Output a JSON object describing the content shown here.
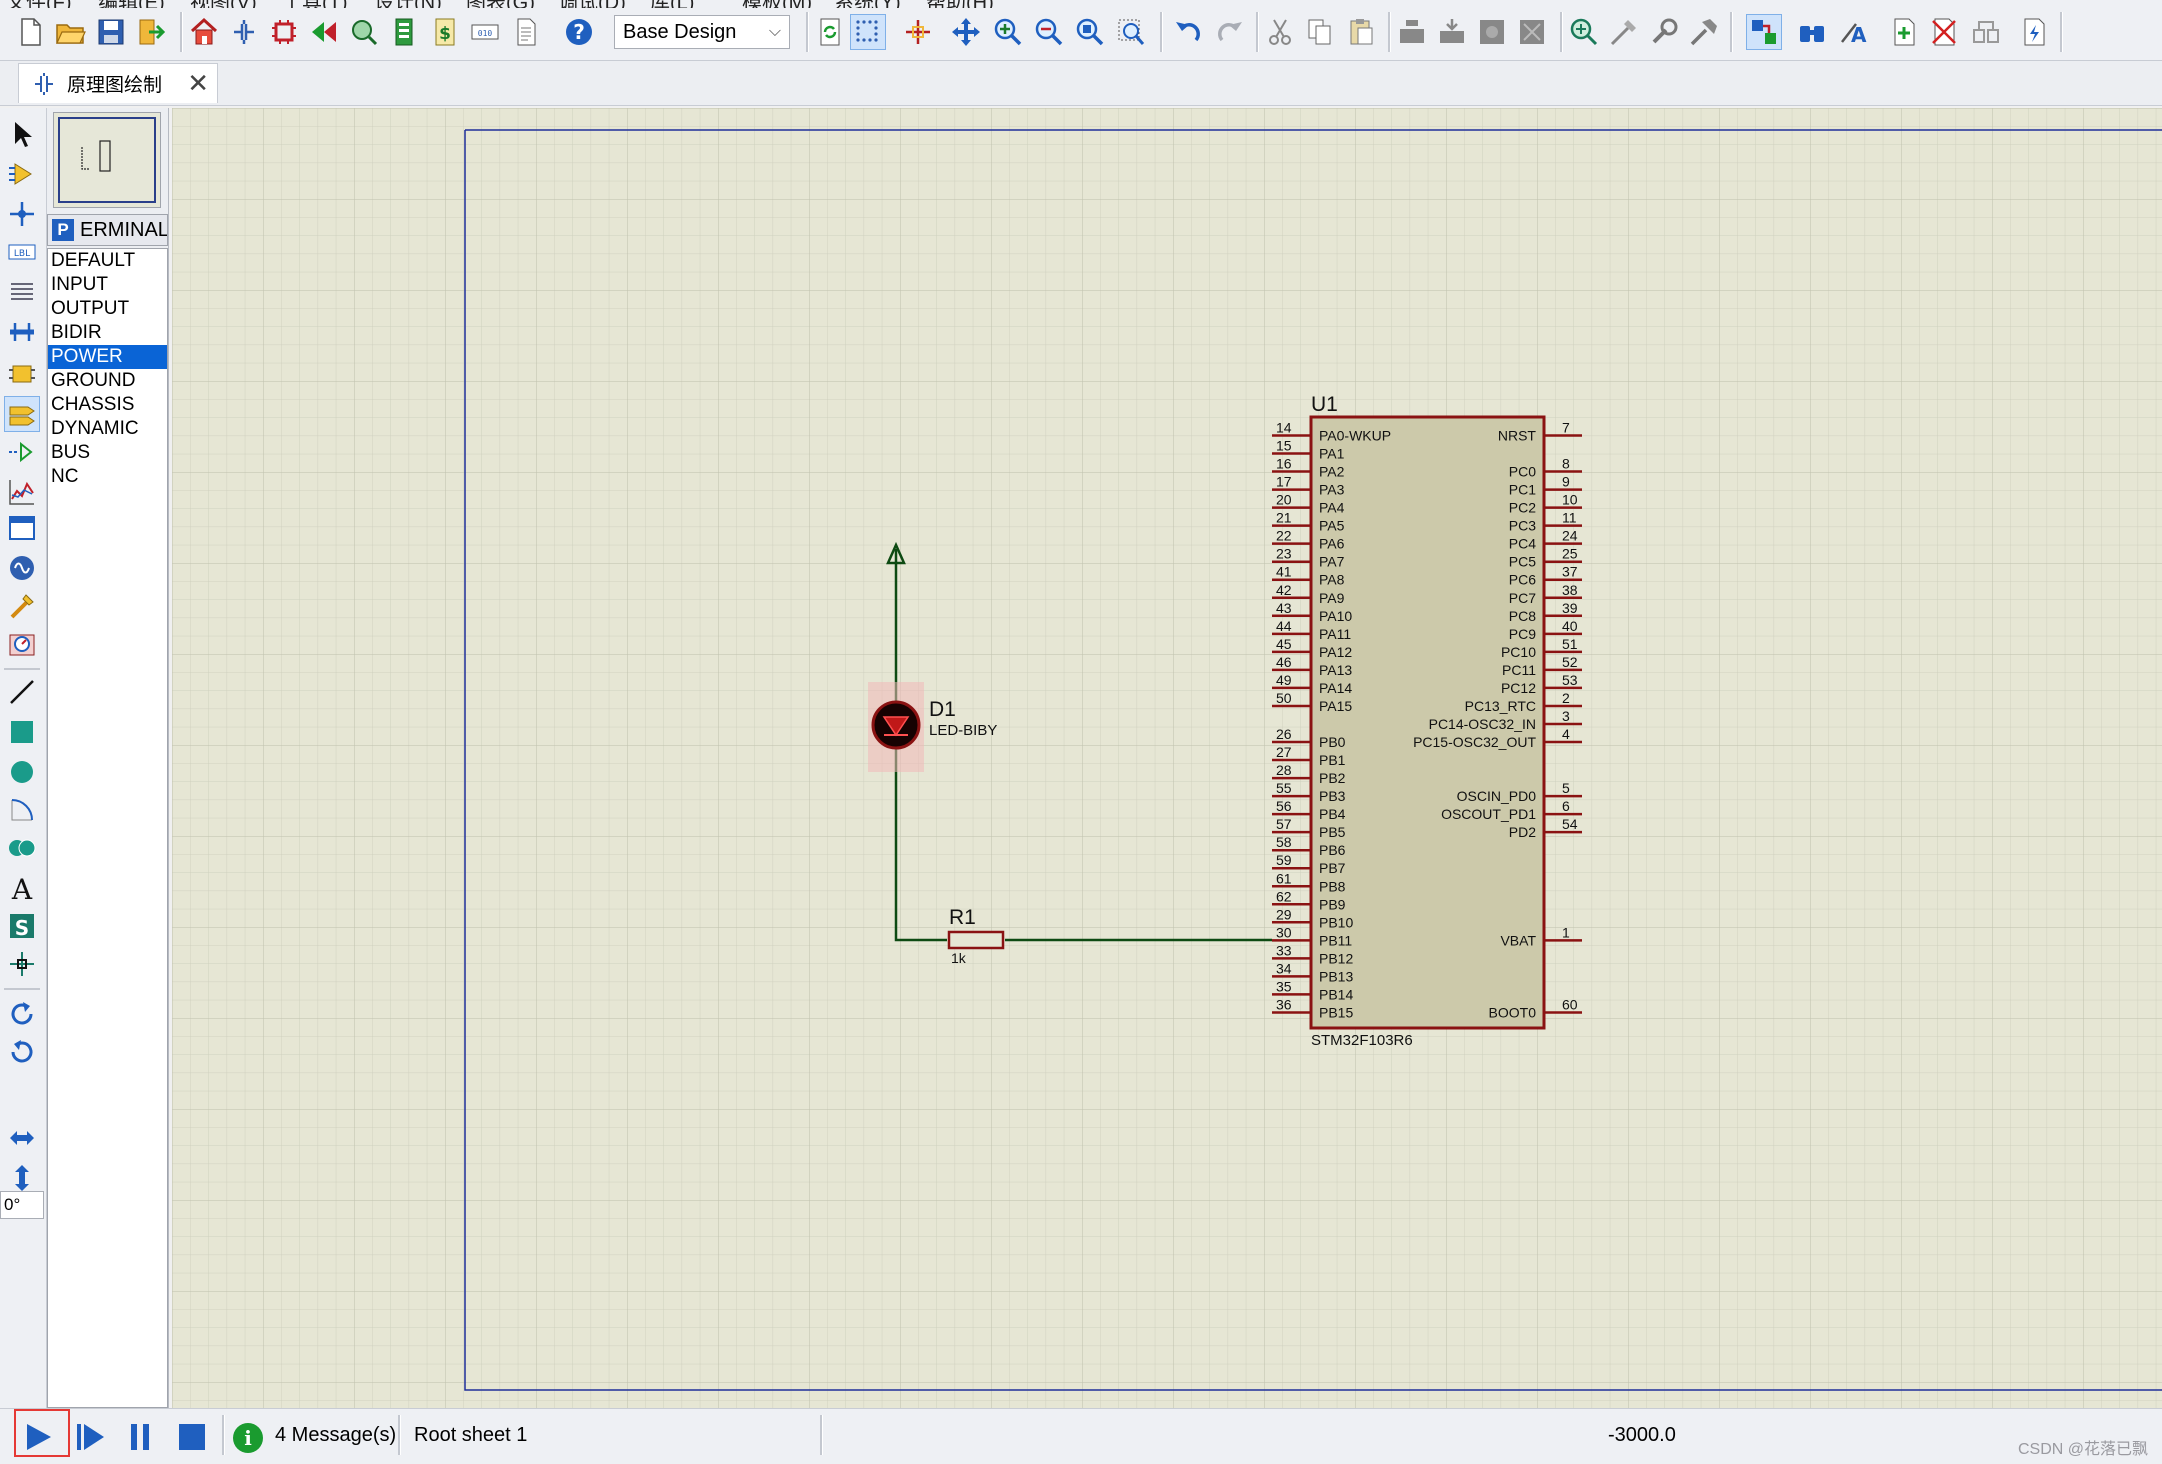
{
  "menu": [
    "文件(F)",
    "编辑(E)",
    "视图(V)",
    "工具(T)",
    "设计(N)",
    "图表(G)",
    "调试(D)",
    "库(L)",
    "模板(M)",
    "系统(Y)",
    "帮助(H)"
  ],
  "toolbar": {
    "design_select_value": "Base Design"
  },
  "tab": {
    "label": "原理图绘制",
    "close_glyph": "✕"
  },
  "left_toolbar": {
    "angle_value": "0°",
    "label_tool_text": "LBL"
  },
  "side_panel": {
    "picker_button": "P",
    "picker_title": "ERMINAL",
    "terminals": [
      "DEFAULT",
      "INPUT",
      "OUTPUT",
      "BIDIR",
      "POWER",
      "GROUND",
      "CHASSIS",
      "DYNAMIC",
      "BUS",
      "NC"
    ],
    "selected": "POWER"
  },
  "schematic": {
    "led": {
      "ref": "D1",
      "value": "LED-BIBY"
    },
    "resistor": {
      "ref": "R1",
      "value": "1k"
    },
    "mcu": {
      "ref": "U1",
      "part": "STM32F103R6",
      "left_pins": [
        {
          "num": "14",
          "name": "PA0-WKUP"
        },
        {
          "num": "15",
          "name": "PA1"
        },
        {
          "num": "16",
          "name": "PA2"
        },
        {
          "num": "17",
          "name": "PA3"
        },
        {
          "num": "20",
          "name": "PA4"
        },
        {
          "num": "21",
          "name": "PA5"
        },
        {
          "num": "22",
          "name": "PA6"
        },
        {
          "num": "23",
          "name": "PA7"
        },
        {
          "num": "41",
          "name": "PA8"
        },
        {
          "num": "42",
          "name": "PA9"
        },
        {
          "num": "43",
          "name": "PA10"
        },
        {
          "num": "44",
          "name": "PA11"
        },
        {
          "num": "45",
          "name": "PA12"
        },
        {
          "num": "46",
          "name": "PA13"
        },
        {
          "num": "49",
          "name": "PA14"
        },
        {
          "num": "50",
          "name": "PA15"
        },
        {
          "num": "26",
          "name": "PB0"
        },
        {
          "num": "27",
          "name": "PB1"
        },
        {
          "num": "28",
          "name": "PB2"
        },
        {
          "num": "55",
          "name": "PB3"
        },
        {
          "num": "56",
          "name": "PB4"
        },
        {
          "num": "57",
          "name": "PB5"
        },
        {
          "num": "58",
          "name": "PB6"
        },
        {
          "num": "59",
          "name": "PB7"
        },
        {
          "num": "61",
          "name": "PB8"
        },
        {
          "num": "62",
          "name": "PB9"
        },
        {
          "num": "29",
          "name": "PB10"
        },
        {
          "num": "30",
          "name": "PB11"
        },
        {
          "num": "33",
          "name": "PB12"
        },
        {
          "num": "34",
          "name": "PB13"
        },
        {
          "num": "35",
          "name": "PB14"
        },
        {
          "num": "36",
          "name": "PB15"
        }
      ],
      "right_pins": [
        {
          "num": "7",
          "name": "NRST",
          "row": 0
        },
        {
          "num": "8",
          "name": "PC0",
          "row": 2
        },
        {
          "num": "9",
          "name": "PC1",
          "row": 3
        },
        {
          "num": "10",
          "name": "PC2",
          "row": 4
        },
        {
          "num": "11",
          "name": "PC3",
          "row": 5
        },
        {
          "num": "24",
          "name": "PC4",
          "row": 6
        },
        {
          "num": "25",
          "name": "PC5",
          "row": 7
        },
        {
          "num": "37",
          "name": "PC6",
          "row": 8
        },
        {
          "num": "38",
          "name": "PC7",
          "row": 9
        },
        {
          "num": "39",
          "name": "PC8",
          "row": 10
        },
        {
          "num": "40",
          "name": "PC9",
          "row": 11
        },
        {
          "num": "51",
          "name": "PC10",
          "row": 12
        },
        {
          "num": "52",
          "name": "PC11",
          "row": 13
        },
        {
          "num": "53",
          "name": "PC12",
          "row": 14
        },
        {
          "num": "2",
          "name": "PC13_RTC",
          "row": 15
        },
        {
          "num": "3",
          "name": "PC14-OSC32_IN",
          "row": 16
        },
        {
          "num": "4",
          "name": "PC15-OSC32_OUT",
          "row": 17
        },
        {
          "num": "5",
          "name": "OSCIN_PD0",
          "row": 20
        },
        {
          "num": "6",
          "name": "OSCOUT_PD1",
          "row": 21
        },
        {
          "num": "54",
          "name": "PD2",
          "row": 22
        },
        {
          "num": "1",
          "name": "VBAT",
          "row": 28
        },
        {
          "num": "60",
          "name": "BOOT0",
          "row": 32
        }
      ]
    }
  },
  "statusbar": {
    "messages": "4 Message(s)",
    "info_glyph": "i",
    "sheet": "Root sheet 1",
    "coordinate": "-3000.0",
    "watermark": "CSDN @花落已飘"
  }
}
